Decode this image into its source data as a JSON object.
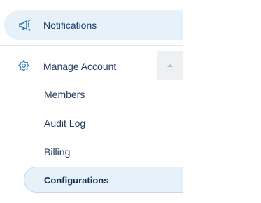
{
  "sidebar": {
    "notifications": {
      "label": "Notifications",
      "icon": "megaphone-icon"
    },
    "manage_account": {
      "label": "Manage Account",
      "icon": "gear-icon",
      "expanded": true,
      "toggle_icon": "caret-up-icon",
      "children": [
        {
          "label": "Members"
        },
        {
          "label": "Audit Log"
        },
        {
          "label": "Billing"
        },
        {
          "label": "Configurations",
          "active": true
        }
      ]
    }
  },
  "colors": {
    "accent": "#1f6fb5",
    "active_bg": "#e6f1fa",
    "text": "#1f3a5c",
    "toggle_bg": "#eef0f2"
  }
}
